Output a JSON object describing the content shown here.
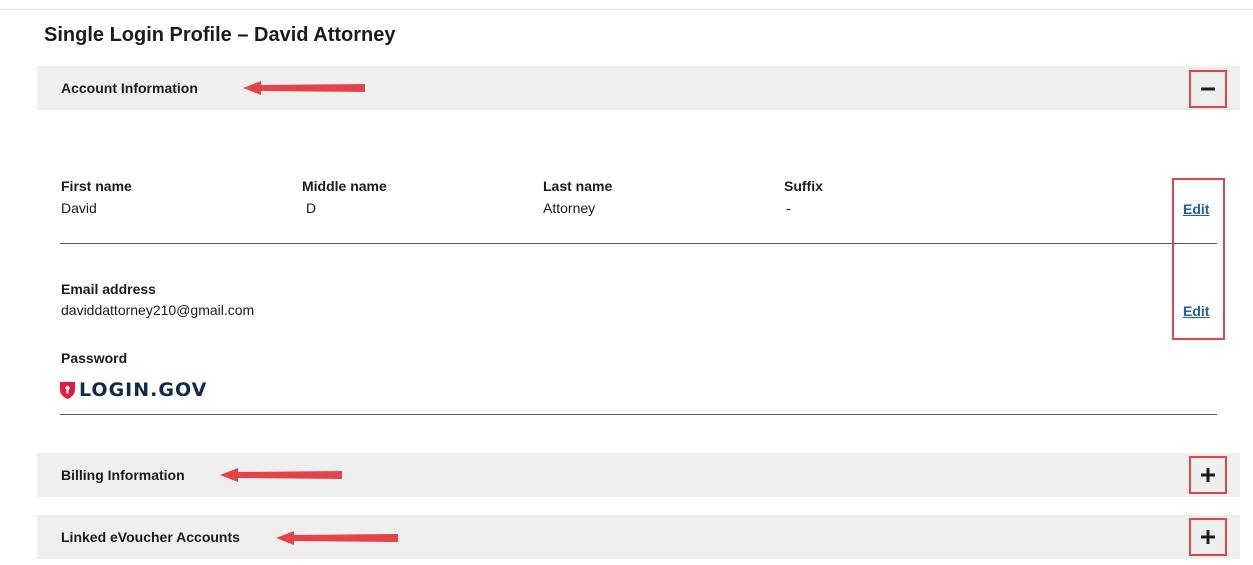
{
  "page": {
    "title": "Single Login Profile –  David Attorney"
  },
  "sections": {
    "account": {
      "label": "Account Information",
      "toggle": "−",
      "expanded": true
    },
    "billing": {
      "label": "Billing Information",
      "toggle": "+",
      "expanded": false
    },
    "linked": {
      "label": "Linked eVoucher Accounts",
      "toggle": "+",
      "expanded": false
    }
  },
  "name": {
    "first_label": "First name",
    "first_value": "David",
    "middle_label": "Middle name",
    "middle_value": "D",
    "last_label": "Last name",
    "last_value": "Attorney",
    "suffix_label": "Suffix",
    "suffix_value": "-",
    "edit_label": "Edit"
  },
  "email": {
    "label": "Email address",
    "value": "daviddattorney210@gmail.com",
    "edit_label": "Edit"
  },
  "password": {
    "label": "Password",
    "logo_text": "LOGIN.GOV",
    "logo_icon": "shield-icon"
  },
  "colors": {
    "annotation_red": "#e2444a",
    "section_bg": "#efefef",
    "link_blue": "#1f5fa8",
    "logo_red": "#e21c3d",
    "logo_navy": "#11294a"
  }
}
